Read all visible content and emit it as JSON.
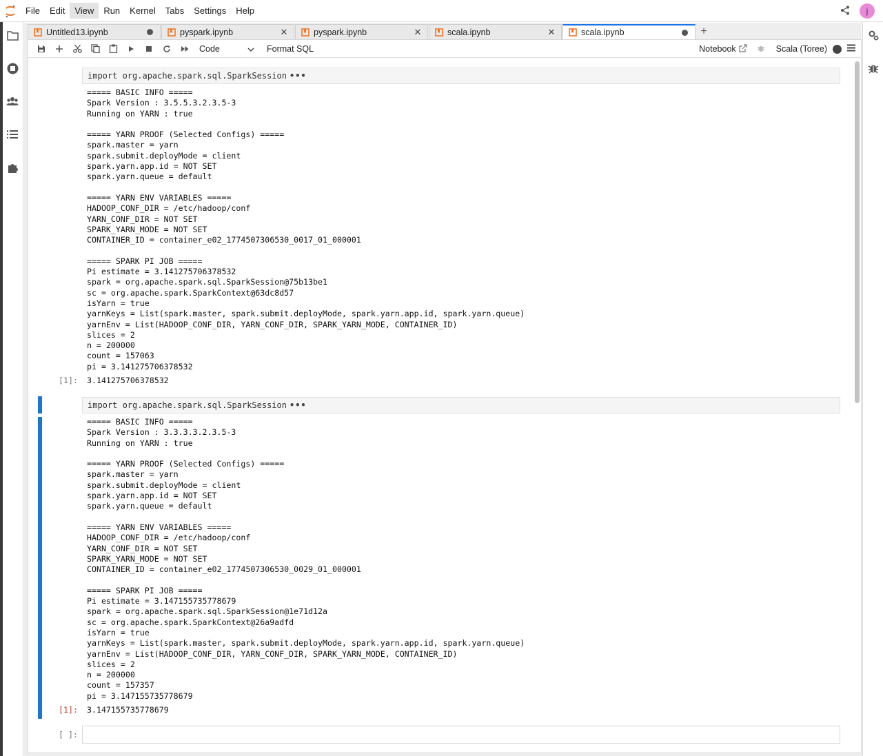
{
  "menu": {
    "items": [
      "File",
      "Edit",
      "View",
      "Run",
      "Kernel",
      "Tabs",
      "Settings",
      "Help"
    ],
    "active": "View",
    "user_initial": "j"
  },
  "tabs": [
    {
      "label": "Untitled13.ipynb",
      "state": "dirty"
    },
    {
      "label": "pyspark.ipynb",
      "state": "close"
    },
    {
      "label": "pyspark.ipynb",
      "state": "close"
    },
    {
      "label": "scala.ipynb",
      "state": "close"
    },
    {
      "label": "scala.ipynb",
      "state": "dirty",
      "active": true
    }
  ],
  "toolbar": {
    "cell_type": "Code",
    "format_sql": "Format SQL",
    "notebook_label": "Notebook",
    "kernel_name": "Scala (Toree)"
  },
  "cells": [
    {
      "input": "import org.apache.spark.sql.SparkSession",
      "output": "===== BASIC INFO =====\nSpark Version : 3.5.5.3.2.3.5-3\nRunning on YARN : true\n\n===== YARN PROOF (Selected Configs) =====\nspark.master = yarn\nspark.submit.deployMode = client\nspark.yarn.app.id = NOT SET\nspark.yarn.queue = default\n\n===== YARN ENV VARIABLES =====\nHADOOP_CONF_DIR = /etc/hadoop/conf\nYARN_CONF_DIR = NOT SET\nSPARK_YARN_MODE = NOT SET\nCONTAINER_ID = container_e02_1774507306530_0017_01_000001\n\n===== SPARK PI JOB =====\nPi estimate = 3.141275706378532\nspark = org.apache.spark.sql.SparkSession@75b13be1\nsc = org.apache.spark.SparkContext@63dc8d57\nisYarn = true\nyarnKeys = List(spark.master, spark.submit.deployMode, spark.yarn.app.id, spark.yarn.queue)\nyarnEnv = List(HADOOP_CONF_DIR, YARN_CONF_DIR, SPARK_YARN_MODE, CONTAINER_ID)\nslices = 2\nn = 200000\ncount = 157063\npi = 3.141275706378532",
      "prompt": "[1]:",
      "result": "3.141275706378532"
    },
    {
      "input": "import org.apache.spark.sql.SparkSession",
      "output": "===== BASIC INFO =====\nSpark Version : 3.3.3.3.2.3.5-3\nRunning on YARN : true\n\n===== YARN PROOF (Selected Configs) =====\nspark.master = yarn\nspark.submit.deployMode = client\nspark.yarn.app.id = NOT SET\nspark.yarn.queue = default\n\n===== YARN ENV VARIABLES =====\nHADOOP_CONF_DIR = /etc/hadoop/conf\nYARN_CONF_DIR = NOT SET\nSPARK_YARN_MODE = NOT SET\nCONTAINER_ID = container_e02_1774507306530_0029_01_000001\n\n===== SPARK PI JOB =====\nPi estimate = 3.147155735778679\nspark = org.apache.spark.sql.SparkSession@1e71d12a\nsc = org.apache.spark.SparkContext@26a9adfd\nisYarn = true\nyarnKeys = List(spark.master, spark.submit.deployMode, spark.yarn.app.id, spark.yarn.queue)\nyarnEnv = List(HADOOP_CONF_DIR, YARN_CONF_DIR, SPARK_YARN_MODE, CONTAINER_ID)\nslices = 2\nn = 200000\ncount = 157357\npi = 3.147155735778679",
      "prompt": "[1]:",
      "result": "3.147155735778679"
    }
  ],
  "empty_cell_prompt": "[ ]:",
  "colors": {
    "active_cell": "#1976d2",
    "active_tab_border": "#1a73e8",
    "prompt_active": "#c0392b",
    "tab_icon": "#f37726"
  }
}
